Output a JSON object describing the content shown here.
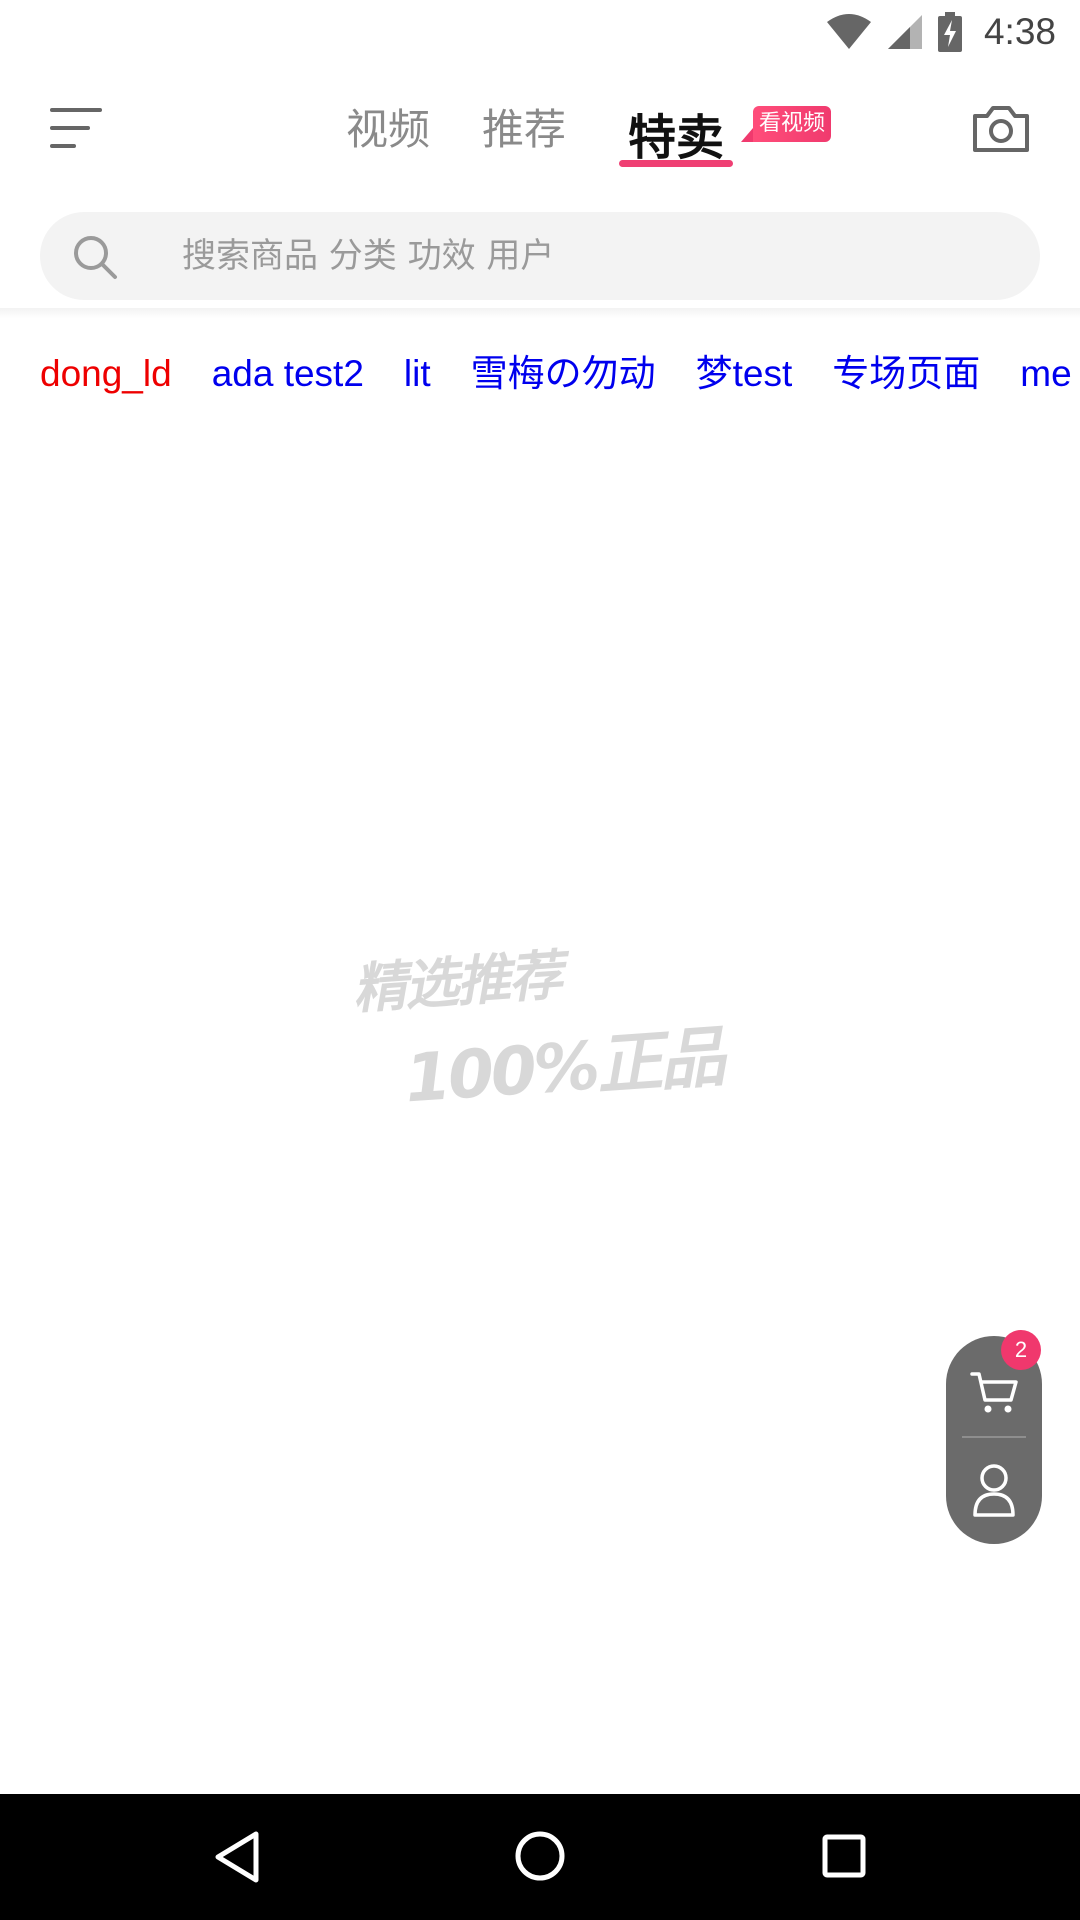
{
  "status_bar": {
    "time": "4:38",
    "icons": [
      "wifi-icon",
      "cellular-signal-icon",
      "battery-charging-icon"
    ]
  },
  "header": {
    "menu_icon": "menu-icon",
    "tabs": [
      {
        "label": "视频",
        "active": false
      },
      {
        "label": "推荐",
        "active": false
      },
      {
        "label": "特卖",
        "active": true
      }
    ],
    "tab_badge": "看视频",
    "camera_icon": "camera-icon"
  },
  "search": {
    "placeholder": "搜索商品 分类 功效 用户",
    "value": ""
  },
  "categories": [
    {
      "label": "dong_ld",
      "active": true
    },
    {
      "label": "ada test2",
      "active": false
    },
    {
      "label": "lit",
      "active": false
    },
    {
      "label": "雪梅の勿动",
      "active": false
    },
    {
      "label": "梦test",
      "active": false
    },
    {
      "label": "专场页面",
      "active": false
    },
    {
      "label": "me",
      "active": false
    }
  ],
  "placeholder_logo": {
    "line1": "精选推荐",
    "line2": "100%正品"
  },
  "float_actions": {
    "cart_count": "2",
    "cart_icon": "shopping-cart-icon",
    "user_icon": "user-icon"
  },
  "colors": {
    "accent": "#ef3f73",
    "active_category": "#ee0000",
    "category_link": "#0000ee",
    "float_panel": "#6b6b6b"
  },
  "system_nav": [
    "back-icon",
    "home-icon",
    "recents-icon"
  ]
}
